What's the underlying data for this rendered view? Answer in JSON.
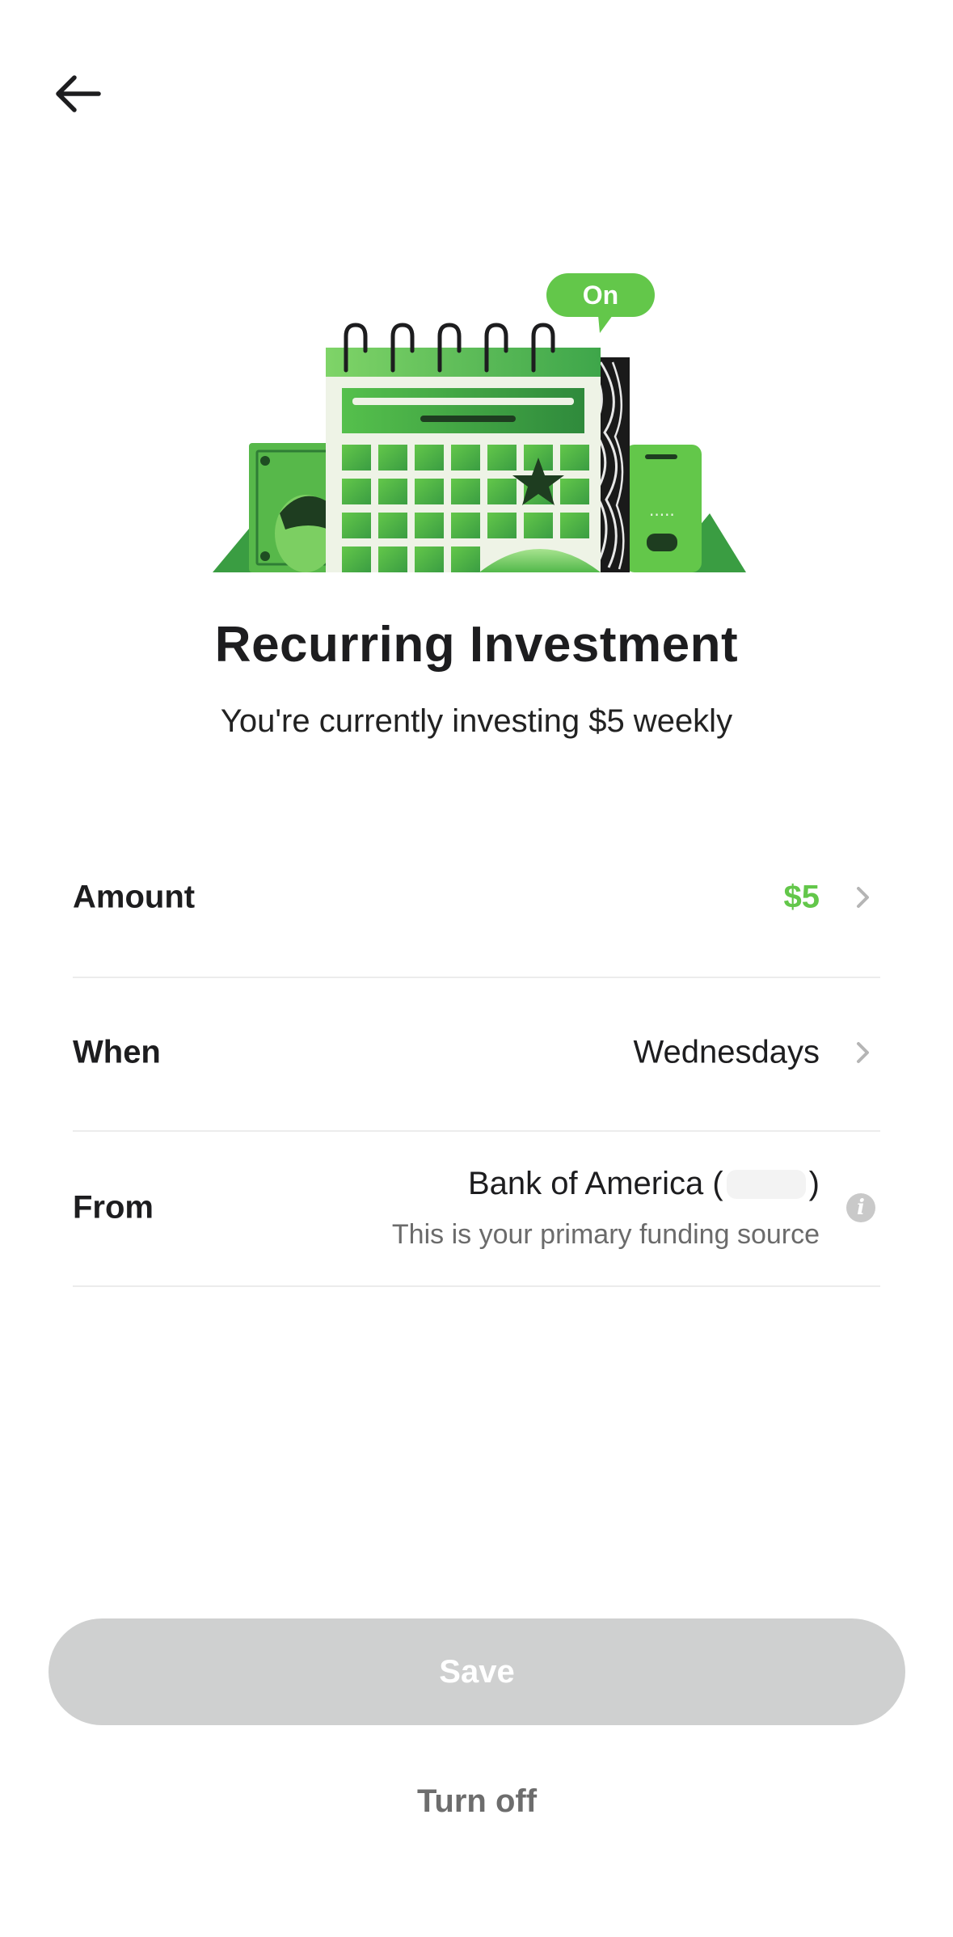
{
  "header": {
    "back_icon": "arrow-left-icon"
  },
  "hero": {
    "badge_label": "On",
    "accent_color": "#63c74a"
  },
  "title": "Recurring Investment",
  "subtitle": "You're currently investing $5 weekly",
  "rows": {
    "amount": {
      "label": "Amount",
      "value": "$5",
      "icon": "chevron-right-icon"
    },
    "when": {
      "label": "When",
      "value": "Wednesdays",
      "icon": "chevron-right-icon"
    },
    "from": {
      "label": "From",
      "bank_name": "Bank of America (",
      "bank_suffix": ")",
      "note": "This is your primary funding source",
      "icon": "info-icon"
    }
  },
  "actions": {
    "save_label": "Save",
    "turn_off_label": "Turn off"
  },
  "colors": {
    "amount_value": "#63c74a",
    "save_button_bg": "#cfd0d0",
    "divider": "#ececec"
  }
}
